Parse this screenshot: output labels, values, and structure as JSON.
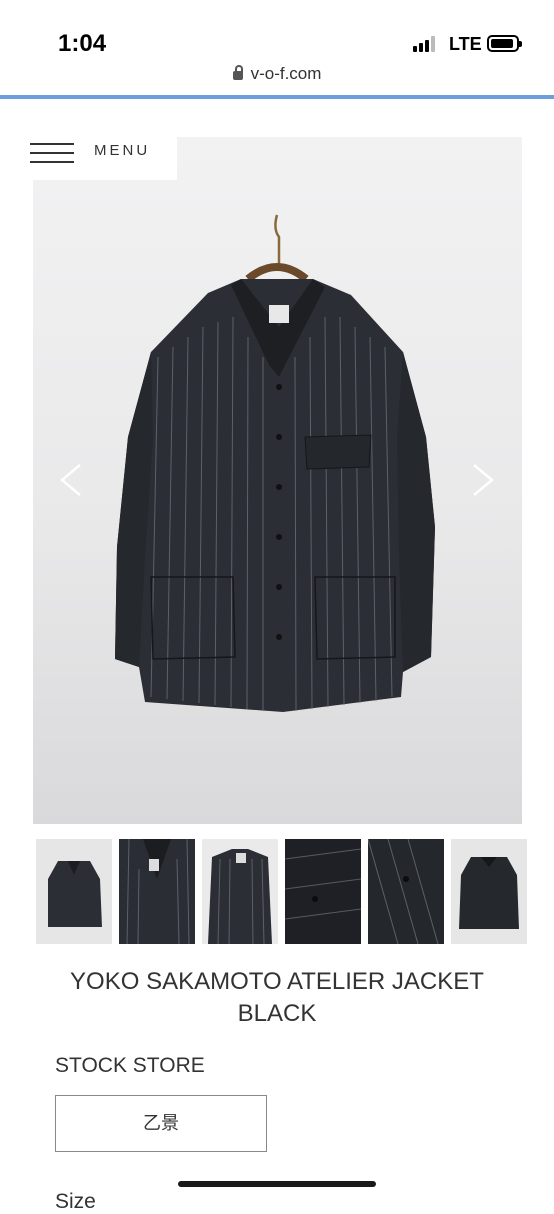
{
  "status_bar": {
    "time": "1:04",
    "network": "LTE"
  },
  "browser": {
    "url": "v-o-f.com"
  },
  "menu": {
    "label": "MENU"
  },
  "product": {
    "title_line1": "YOKO SAKAMOTO ATELIER JACKET",
    "title_line2": "BLACK",
    "stock_label": "STOCK STORE",
    "store_button": "乙景",
    "size_label": "Size"
  },
  "gallery": {
    "thumbnail_count": 6,
    "selected_index": 0
  },
  "colors": {
    "accent_line": "#6d9fdb",
    "jacket": "#2a2d33",
    "background": "#ececed"
  }
}
